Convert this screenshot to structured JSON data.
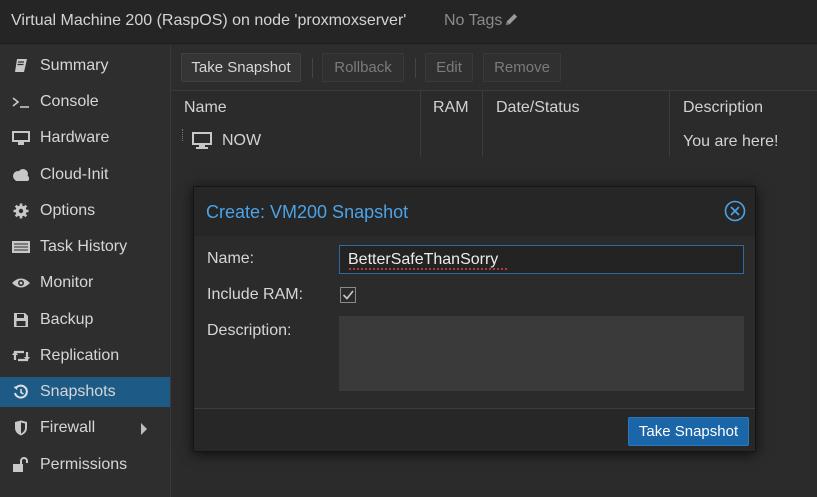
{
  "header": {
    "vm_title": "Virtual Machine 200 (RaspOS) on node 'proxmoxserver'",
    "tags_text": "No Tags",
    "tags_icon": "pencil-icon"
  },
  "sidebar": {
    "items": [
      {
        "label": "Summary",
        "icon": "book-icon"
      },
      {
        "label": "Console",
        "icon": "terminal-icon"
      },
      {
        "label": "Hardware",
        "icon": "monitor-icon"
      },
      {
        "label": "Cloud-Init",
        "icon": "cloud-icon"
      },
      {
        "label": "Options",
        "icon": "gear-icon"
      },
      {
        "label": "Task History",
        "icon": "list-icon"
      },
      {
        "label": "Monitor",
        "icon": "eye-icon"
      },
      {
        "label": "Backup",
        "icon": "floppy-icon"
      },
      {
        "label": "Replication",
        "icon": "retweet-icon"
      },
      {
        "label": "Snapshots",
        "icon": "history-icon",
        "active": true
      },
      {
        "label": "Firewall",
        "icon": "shield-icon",
        "has_submenu": true
      },
      {
        "label": "Permissions",
        "icon": "unlock-icon"
      }
    ]
  },
  "toolbar": {
    "take_snapshot": "Take Snapshot",
    "rollback": "Rollback",
    "edit": "Edit",
    "remove": "Remove"
  },
  "grid": {
    "columns": [
      "Name",
      "RAM",
      "Date/Status",
      "Description"
    ],
    "rows": [
      {
        "name": "NOW",
        "ram": "",
        "date_status": "",
        "description": "You are here!"
      }
    ]
  },
  "dialog": {
    "title": "Create: VM200 Snapshot",
    "name_label": "Name:",
    "name_value": "BetterSafeThanSorry",
    "include_ram_label": "Include RAM:",
    "include_ram_checked": true,
    "description_label": "Description:",
    "description_value": "",
    "submit_label": "Take Snapshot"
  },
  "colors": {
    "accent": "#1a66a8",
    "title_blue": "#4ba3e8",
    "active_nav": "#1e5a86"
  }
}
